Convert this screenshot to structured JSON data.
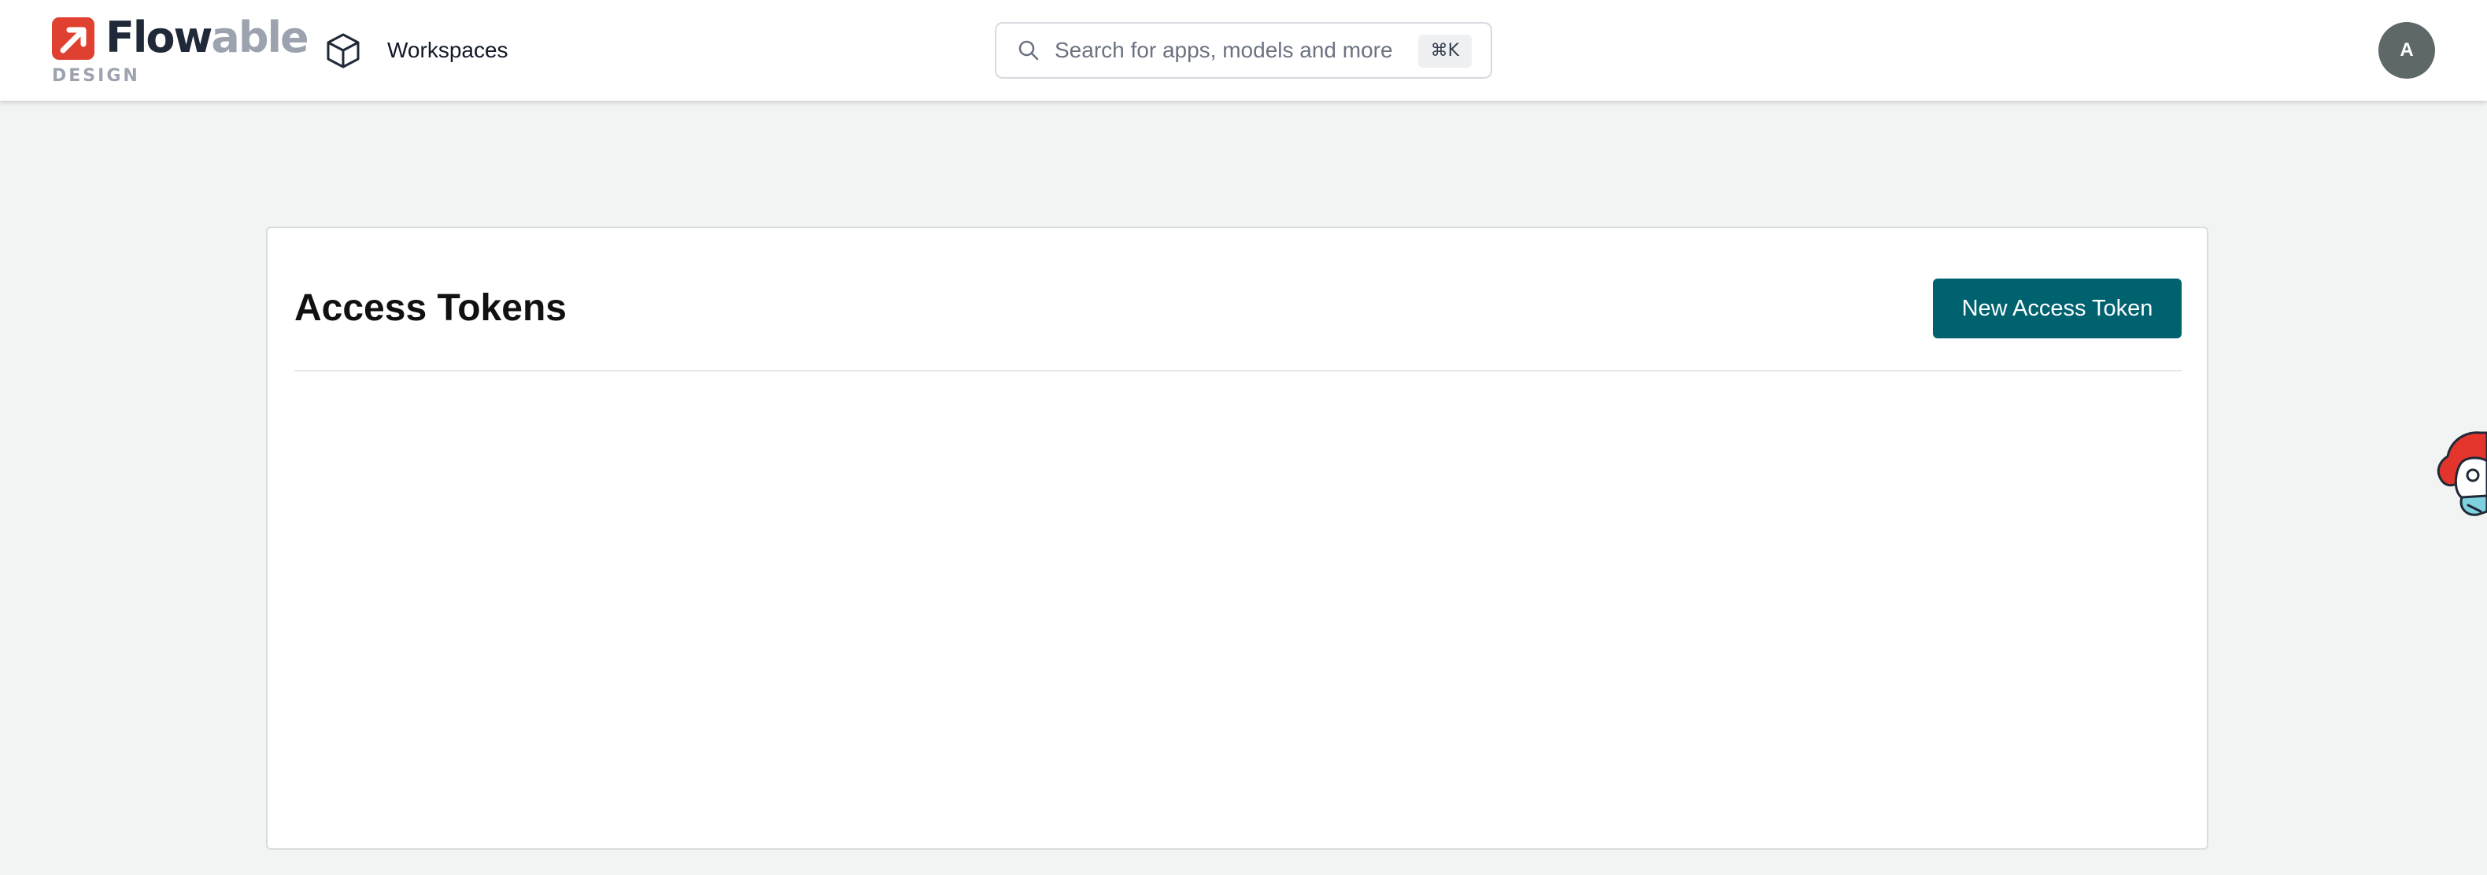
{
  "header": {
    "logo": {
      "word_part1": "Flow",
      "word_part2": "able",
      "subtitle": "DESIGN",
      "brand_color": "#e0402f"
    },
    "nav": {
      "workspaces_label": "Workspaces",
      "workspaces_icon": "cube-icon"
    },
    "search": {
      "placeholder": "Search for apps, models and more",
      "value": "",
      "shortcut": "⌘K",
      "icon": "search-icon"
    },
    "avatar": {
      "initial": "A",
      "color": "#5f6869"
    }
  },
  "main": {
    "title": "Access Tokens",
    "new_button_label": "New Access Token",
    "accent_color": "#00616f",
    "tokens": []
  },
  "mascot": {
    "icon": "flowable-mascot-icon"
  }
}
